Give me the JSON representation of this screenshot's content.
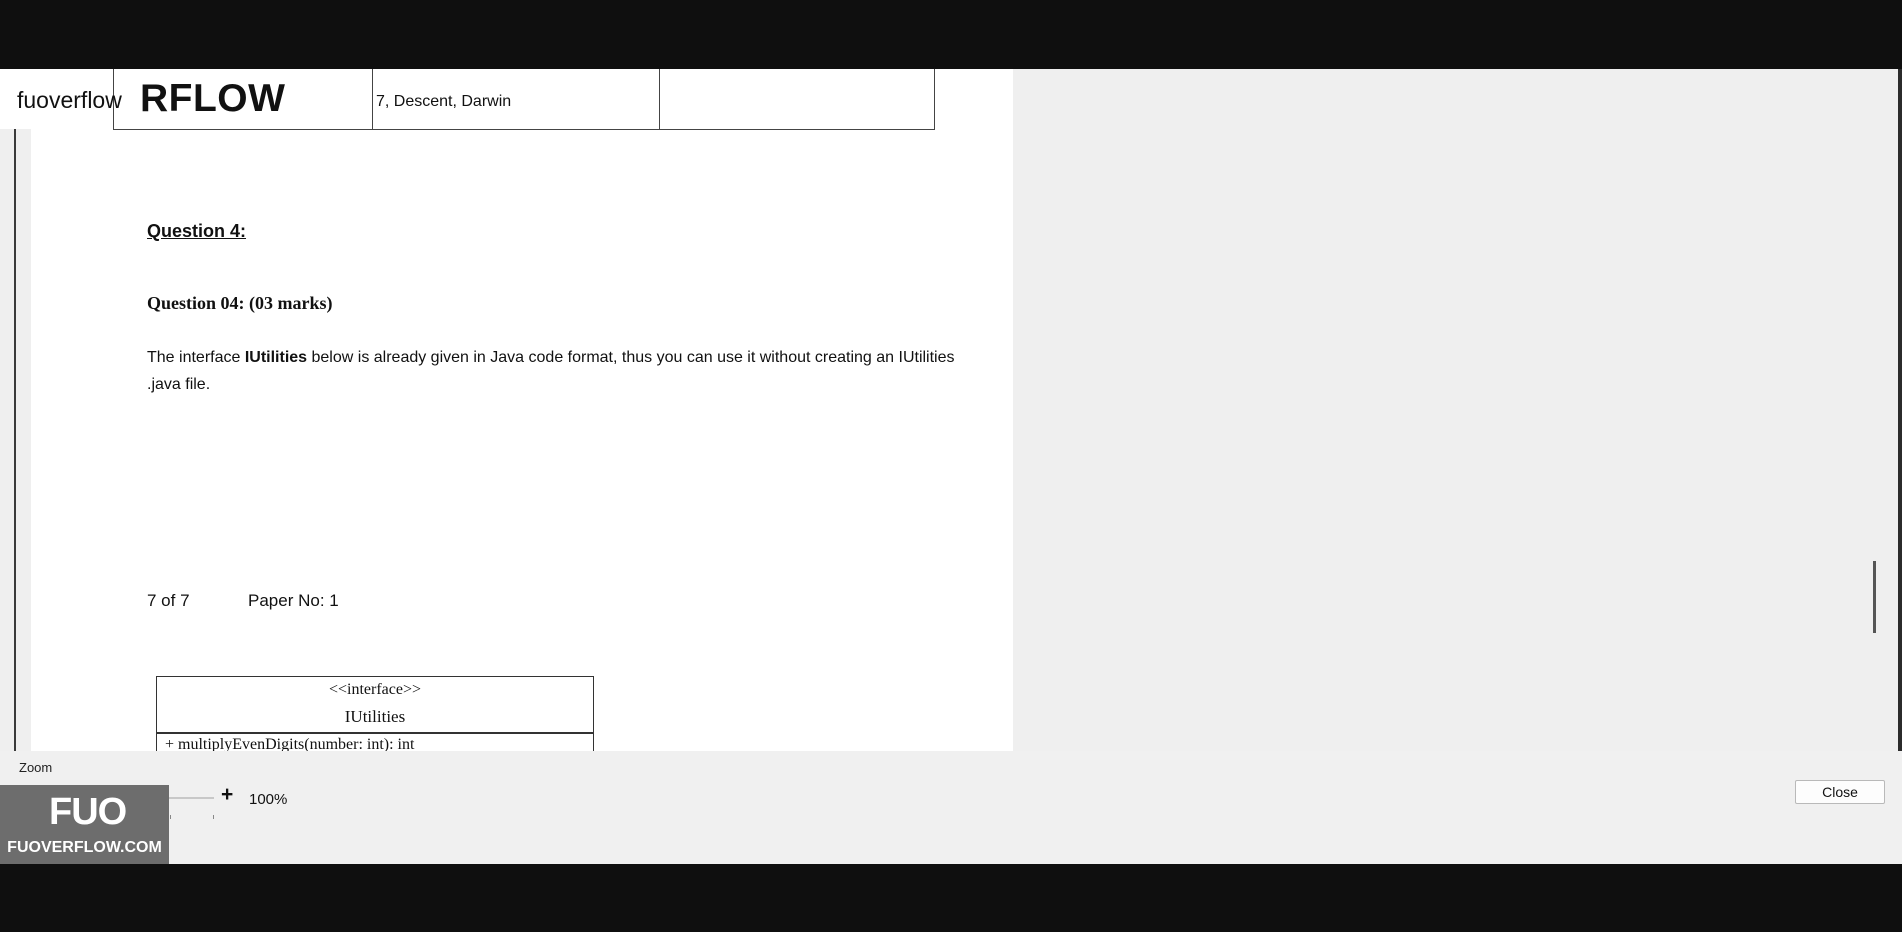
{
  "watermark": {
    "brand_small": "fuoverflow",
    "brand_big": "RFLOW",
    "logo": "FUO",
    "site": "FUOVERFLOW.COM"
  },
  "document": {
    "previous_table_cell": "7, Descent, Darwin",
    "question_heading": "Question 4:",
    "question_subheading": "Question 04: (03 marks)",
    "body_before": "The interface ",
    "body_bold": "IUtilities",
    "body_after": " below is already given in Java code format, thus you can use it without creating an IUtilities .java file.",
    "footer_page": "7 of 7",
    "footer_paper": "Paper No: 1",
    "uml": {
      "stereotype": "<<interface>>",
      "name": "IUtilities",
      "method": "+ multiplyEvenDigits(number: int): int"
    }
  },
  "toolbar": {
    "zoom_label": "Zoom",
    "zoom_minus": "-",
    "zoom_plus": "+",
    "zoom_value": "100%",
    "zoom_level_fraction": 0.48,
    "close_label": "Close"
  },
  "colors": {
    "slider_thumb": "#0a5db5",
    "page_background": "#ffffff",
    "viewer_background": "#efefef"
  }
}
